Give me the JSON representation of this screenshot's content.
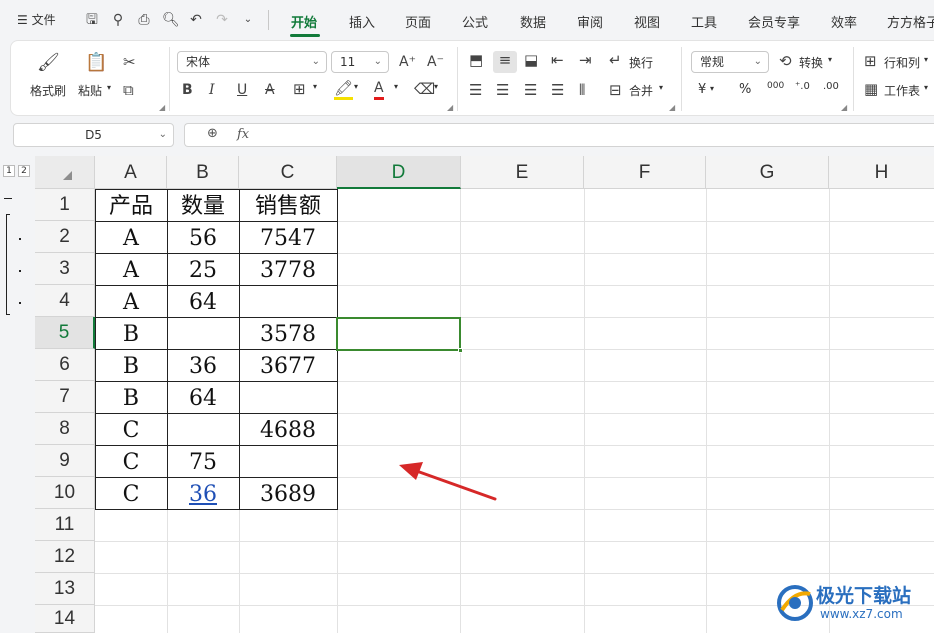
{
  "menubar": {
    "file_label": "文件",
    "tabs": [
      "开始",
      "插入",
      "页面",
      "公式",
      "数据",
      "审阅",
      "视图",
      "工具",
      "会员专享",
      "效率",
      "方方格子"
    ]
  },
  "ribbon": {
    "format_painter": "格式刷",
    "paste": "粘贴",
    "font_name": "宋体",
    "font_size": "11",
    "wrap": "换行",
    "merge": "合并",
    "number_format": "常规",
    "convert": "转换",
    "rows_cols": "行和列",
    "worksheet": "工作表",
    "bold": "B",
    "italic": "I",
    "underline": "U",
    "strike": "A",
    "grow_font": "A⁺",
    "shrink_font": "A⁻",
    "currency": "¥",
    "percent": "%",
    "thousands": "000",
    "inc_decimal": "⁺.0",
    "dec_decimal": ".00",
    "colors": {
      "highlight": "#f5e000",
      "font_color": "#e21b1b",
      "accent": "#127a3a"
    }
  },
  "formula_bar": {
    "name_box": "D5",
    "fx": "fx",
    "content": ""
  },
  "grid": {
    "outline_levels": [
      "1",
      "2"
    ],
    "columns": [
      "A",
      "B",
      "C",
      "D",
      "E",
      "F",
      "G",
      "H"
    ],
    "selected_column": "D",
    "rows": [
      "1",
      "2",
      "3",
      "4",
      "5",
      "6",
      "7",
      "8",
      "9",
      "10",
      "11",
      "12",
      "13",
      "14"
    ],
    "selected_row": "5",
    "selected_cell": "D5",
    "table": [
      [
        "产品",
        "数量",
        "销售额"
      ],
      [
        "A",
        "56",
        "7547"
      ],
      [
        "A",
        "25",
        "3778"
      ],
      [
        "A",
        "64",
        ""
      ],
      [
        "B",
        "",
        "3578"
      ],
      [
        "B",
        "36",
        "3677"
      ],
      [
        "B",
        "64",
        ""
      ],
      [
        "C",
        "",
        "4688"
      ],
      [
        "C",
        "75",
        ""
      ],
      [
        "C",
        "36",
        "3689"
      ]
    ]
  },
  "annotation": {
    "arrow_color": "#d62828"
  },
  "watermark": {
    "name": "极光下载站",
    "url": "www.xz7.com"
  }
}
